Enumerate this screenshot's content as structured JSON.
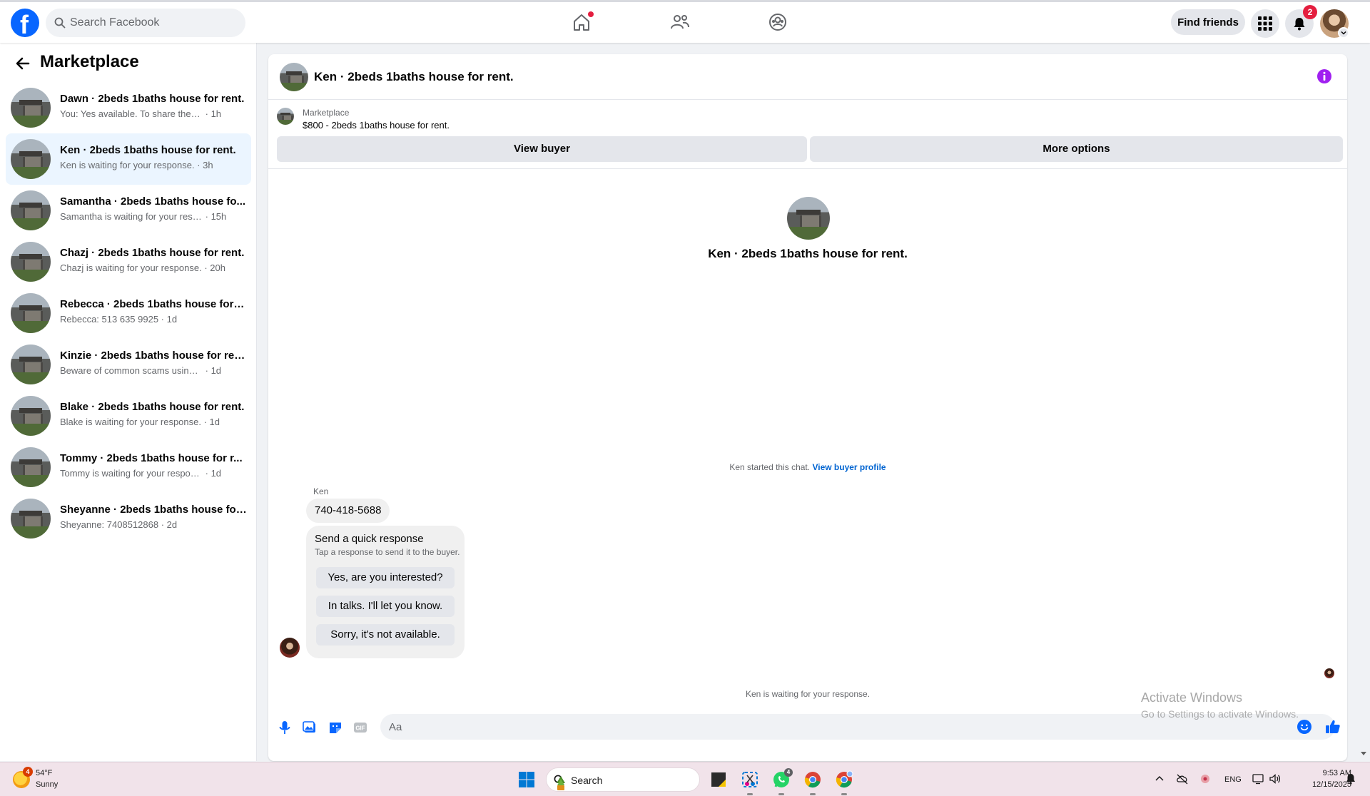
{
  "topbar": {
    "logo_letter": "f",
    "search_placeholder": "Search Facebook",
    "find_friends_label": "Find friends",
    "notification_count": "2",
    "brand_color": "#0866ff",
    "icons": [
      "home-icon",
      "friends-icon",
      "groups-icon",
      "menu-grid-icon",
      "bell-icon"
    ]
  },
  "sidebar": {
    "title": "Marketplace",
    "conversations": [
      {
        "name": "Dawn · 2beds 1baths house for rent.",
        "preview": "You: Yes available. To share the address...",
        "time": "1h",
        "active": false
      },
      {
        "name": "Ken · 2beds 1baths house for rent.",
        "preview": "Ken is waiting for your response.",
        "time": "3h",
        "active": true
      },
      {
        "name": "Samantha · 2beds 1baths house fo...",
        "preview": "Samantha is waiting for your respon...",
        "time": "15h",
        "active": false
      },
      {
        "name": "Chazj · 2beds 1baths house for rent.",
        "preview": "Chazj is waiting for your response.",
        "time": "20h",
        "active": false
      },
      {
        "name": "Rebecca · 2beds 1baths house for r...",
        "preview": "Rebecca: 513 635 9925",
        "time": "1d",
        "active": false
      },
      {
        "name": "Kinzie · 2beds 1baths house for rent.",
        "preview": "Beware of common scams using pay...",
        "time": "1d",
        "active": false
      },
      {
        "name": "Blake · 2beds 1baths house for rent.",
        "preview": "Blake is waiting for your response.",
        "time": "1d",
        "active": false
      },
      {
        "name": "Tommy · 2beds 1baths house for r...",
        "preview": "Tommy is waiting for your response.",
        "time": "1d",
        "active": false
      },
      {
        "name": "Sheyanne · 2beds 1baths house for...",
        "preview": "Sheyanne: 7408512868",
        "time": "2d",
        "active": false
      }
    ]
  },
  "chat": {
    "title": "Ken · 2beds 1baths house for rent.",
    "listing_source": "Marketplace",
    "listing_price": "$800 - 2beds 1baths house for rent.",
    "view_buyer_label": "View buyer",
    "more_options_label": "More options",
    "intro_title": "Ken · 2beds 1baths house for rent.",
    "started_text": "Ken started this chat.",
    "view_profile_link": "View buyer profile",
    "sender_name": "Ken",
    "message": "740-418-5688",
    "quick_response": {
      "title": "Send a quick response",
      "subtitle": "Tap a response to send it to the buyer.",
      "options": [
        "Yes, are you interested?",
        "In talks. I'll let you know.",
        "Sorry, it's not available."
      ]
    },
    "waiting_text": "Ken is waiting for your response.",
    "composer_placeholder": "Aa",
    "accent_color": "#0866ff",
    "info_color": "#a020f0"
  },
  "watermark": {
    "title": "Activate Windows",
    "subtitle": "Go to Settings to activate Windows."
  },
  "taskbar": {
    "weather_temp": "54°F",
    "weather_desc": "Sunny",
    "weather_badge": "4",
    "search_label": "Search",
    "whatsapp_badge": "4",
    "language": "ENG",
    "time": "9:53 AM",
    "date": "12/15/2025"
  }
}
